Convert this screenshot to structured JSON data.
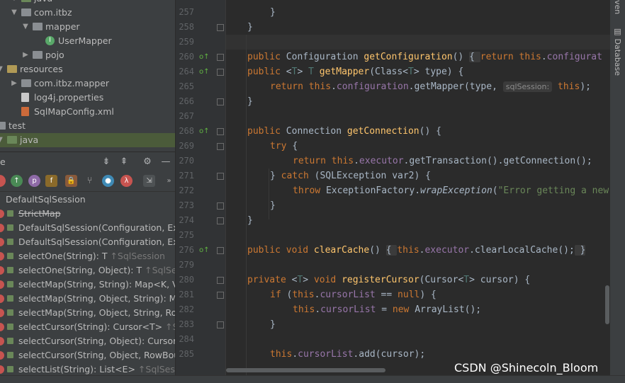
{
  "project_tree": [
    {
      "label": "java",
      "icon": "source-folder-icon",
      "arrow": "v"
    },
    {
      "label": "com.itbz",
      "icon": "package-icon",
      "arrow": "v"
    },
    {
      "label": "mapper",
      "icon": "package-icon",
      "arrow": "v"
    },
    {
      "label": "UserMapper",
      "icon": "interface-icon",
      "arrow": ""
    },
    {
      "label": "pojo",
      "icon": "package-icon",
      "arrow": ">"
    },
    {
      "label": "resources",
      "icon": "resources-folder-icon",
      "arrow": "v"
    },
    {
      "label": "com.itbz.mapper",
      "icon": "package-icon",
      "arrow": ">"
    },
    {
      "label": "log4j.properties",
      "icon": "properties-file-icon",
      "arrow": ""
    },
    {
      "label": "SqlMapConfig.xml",
      "icon": "xml-file-icon",
      "arrow": ""
    },
    {
      "label": "test",
      "icon": "folder-icon",
      "arrow": "v"
    },
    {
      "label": "java",
      "icon": "source-folder-icon",
      "arrow": "v"
    }
  ],
  "structure_panel": {
    "title": "e",
    "root": "DefaultSqlSession",
    "header_icons": [
      "expand-all-icon",
      "collapse-all-icon",
      "gear-icon",
      "minimize-icon"
    ],
    "toolbar_icons": [
      "inherited-icon",
      "properties-icon",
      "fields-icon",
      "non-public-icon",
      "anonymous-classes-icon",
      "navigate-icon",
      "lambdas-icon",
      "autoscroll-icon",
      "more-icon"
    ],
    "items": [
      {
        "name": "StrictMap",
        "suffix": "",
        "deprecated": true
      },
      {
        "name": "DefaultSqlSession(Configuration, Exec",
        "suffix": "",
        "deprecated": false
      },
      {
        "name": "DefaultSqlSession(Configuration, Exec",
        "suffix": "",
        "deprecated": false
      },
      {
        "name": "selectOne(String): T",
        "suffix": "↑SqlSession",
        "deprecated": false
      },
      {
        "name": "selectOne(String, Object): T",
        "suffix": "↑SqlSession",
        "deprecated": false
      },
      {
        "name": "selectMap(String, String): Map<K, V>",
        "suffix": "↑",
        "deprecated": false
      },
      {
        "name": "selectMap(String, Object, String): Map",
        "suffix": "",
        "deprecated": false
      },
      {
        "name": "selectMap(String, Object, String, RowB",
        "suffix": "",
        "deprecated": false
      },
      {
        "name": "selectCursor(String): Cursor<T>",
        "suffix": "↑SqlS",
        "deprecated": false
      },
      {
        "name": "selectCursor(String, Object): Cursor<T",
        "suffix": "",
        "deprecated": false
      },
      {
        "name": "selectCursor(String, Object, RowBound",
        "suffix": "",
        "deprecated": false
      },
      {
        "name": "selectList(String): List<E>",
        "suffix": "↑SqlSession",
        "deprecated": false
      }
    ]
  },
  "line_numbers": [
    "257",
    "258",
    "259",
    "260",
    "264",
    "265",
    "266",
    "267",
    "268",
    "269",
    "270",
    "271",
    "272",
    "273",
    "274",
    "275",
    "276",
    "279",
    "280",
    "281",
    "282",
    "283",
    "284",
    "285"
  ],
  "code_lines": [
    {
      "segs": [
        {
          "t": "}",
          "c": ""
        }
      ],
      "indent": 1
    },
    {
      "segs": [
        {
          "t": "}",
          "c": ""
        }
      ],
      "indent": 0
    },
    {
      "segs": [],
      "indent": 0
    },
    {
      "segs": [
        {
          "t": "public ",
          "c": "kw"
        },
        {
          "t": "Configuration ",
          "c": ""
        },
        {
          "t": "getConfiguration",
          "c": "fn"
        },
        {
          "t": "() ",
          "c": ""
        },
        {
          "t": "{ ",
          "c": "fb"
        },
        {
          "t": "return this",
          "c": "kw"
        },
        {
          "t": ".",
          "c": ""
        },
        {
          "t": "configurat",
          "c": "fld"
        }
      ],
      "indent": 0
    },
    {
      "segs": [
        {
          "t": "public ",
          "c": "kw"
        },
        {
          "t": "<",
          "c": ""
        },
        {
          "t": "T",
          "c": "tp"
        },
        {
          "t": "> ",
          "c": ""
        },
        {
          "t": "T ",
          "c": "tp"
        },
        {
          "t": "getMapper",
          "c": "fn"
        },
        {
          "t": "(Class<",
          "c": ""
        },
        {
          "t": "T",
          "c": "tp"
        },
        {
          "t": "> type) {",
          "c": ""
        }
      ],
      "indent": 0
    },
    {
      "segs": [
        {
          "t": "return this",
          "c": "kw"
        },
        {
          "t": ".",
          "c": ""
        },
        {
          "t": "configuration",
          "c": "fld"
        },
        {
          "t": ".getMapper(type, ",
          "c": ""
        },
        {
          "t": "sqlSession:",
          "c": "hint"
        },
        {
          "t": " this",
          "c": "kw"
        },
        {
          "t": ");",
          "c": ""
        }
      ],
      "indent": 1
    },
    {
      "segs": [
        {
          "t": "}",
          "c": ""
        }
      ],
      "indent": 0
    },
    {
      "segs": [],
      "indent": 0
    },
    {
      "segs": [
        {
          "t": "public ",
          "c": "kw"
        },
        {
          "t": "Connection ",
          "c": ""
        },
        {
          "t": "getConnection",
          "c": "fn"
        },
        {
          "t": "() {",
          "c": ""
        }
      ],
      "indent": 0
    },
    {
      "segs": [
        {
          "t": "try ",
          "c": "kw"
        },
        {
          "t": "{",
          "c": ""
        }
      ],
      "indent": 1
    },
    {
      "segs": [
        {
          "t": "return this",
          "c": "kw"
        },
        {
          "t": ".",
          "c": ""
        },
        {
          "t": "executor",
          "c": "fld"
        },
        {
          "t": ".getTransaction().getConnection();",
          "c": ""
        }
      ],
      "indent": 2
    },
    {
      "segs": [
        {
          "t": "} ",
          "c": ""
        },
        {
          "t": "catch ",
          "c": "kw"
        },
        {
          "t": "(SQLException var2) {",
          "c": ""
        }
      ],
      "indent": 1
    },
    {
      "segs": [
        {
          "t": "throw ",
          "c": "kw"
        },
        {
          "t": "ExceptionFactory.",
          "c": ""
        },
        {
          "t": "wrapException",
          "c": "it"
        },
        {
          "t": "(",
          "c": ""
        },
        {
          "t": "\"Error getting a new",
          "c": "str"
        }
      ],
      "indent": 2
    },
    {
      "segs": [
        {
          "t": "}",
          "c": ""
        }
      ],
      "indent": 1
    },
    {
      "segs": [
        {
          "t": "}",
          "c": ""
        }
      ],
      "indent": 0
    },
    {
      "segs": [],
      "indent": 0
    },
    {
      "segs": [
        {
          "t": "public void ",
          "c": "kw"
        },
        {
          "t": "clearCache",
          "c": "fn"
        },
        {
          "t": "() ",
          "c": ""
        },
        {
          "t": "{ ",
          "c": "fb"
        },
        {
          "t": "this",
          "c": "kw"
        },
        {
          "t": ".",
          "c": ""
        },
        {
          "t": "executor",
          "c": "fld"
        },
        {
          "t": ".clearLocalCache();",
          "c": ""
        },
        {
          "t": " }",
          "c": "fb"
        }
      ],
      "indent": 0
    },
    {
      "segs": [],
      "indent": 0
    },
    {
      "segs": [
        {
          "t": "private ",
          "c": "kw"
        },
        {
          "t": "<",
          "c": ""
        },
        {
          "t": "T",
          "c": "tp"
        },
        {
          "t": "> ",
          "c": ""
        },
        {
          "t": "void ",
          "c": "kw"
        },
        {
          "t": "registerCursor",
          "c": "fn"
        },
        {
          "t": "(Cursor<",
          "c": ""
        },
        {
          "t": "T",
          "c": "tp"
        },
        {
          "t": "> cursor) {",
          "c": ""
        }
      ],
      "indent": 0
    },
    {
      "segs": [
        {
          "t": "if ",
          "c": "kw"
        },
        {
          "t": "(",
          "c": ""
        },
        {
          "t": "this",
          "c": "kw"
        },
        {
          "t": ".",
          "c": ""
        },
        {
          "t": "cursorList",
          "c": "fld"
        },
        {
          "t": " == ",
          "c": ""
        },
        {
          "t": "null",
          "c": "kw"
        },
        {
          "t": ") {",
          "c": ""
        }
      ],
      "indent": 1
    },
    {
      "segs": [
        {
          "t": "this",
          "c": "kw"
        },
        {
          "t": ".",
          "c": ""
        },
        {
          "t": "cursorList",
          "c": "fld"
        },
        {
          "t": " = ",
          "c": ""
        },
        {
          "t": "new ",
          "c": "kw"
        },
        {
          "t": "ArrayList();",
          "c": ""
        }
      ],
      "indent": 2
    },
    {
      "segs": [
        {
          "t": "}",
          "c": ""
        }
      ],
      "indent": 1
    },
    {
      "segs": [],
      "indent": 0
    },
    {
      "segs": [
        {
          "t": "this",
          "c": "kw"
        },
        {
          "t": ".",
          "c": ""
        },
        {
          "t": "cursorList",
          "c": "fld"
        },
        {
          "t": ".add(cursor);",
          "c": ""
        }
      ],
      "indent": 1
    }
  ],
  "right_strip": {
    "top_label": "ven",
    "database_label": "Database"
  },
  "watermark": "CSDN @Shinecoln_Bloom"
}
